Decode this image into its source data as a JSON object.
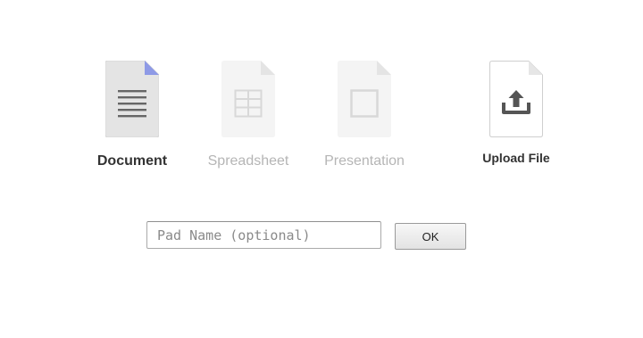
{
  "pad_types": [
    {
      "label": "Document",
      "icon": "document-lines-icon",
      "selected": true
    },
    {
      "label": "Spreadsheet",
      "icon": "spreadsheet-grid-icon",
      "selected": false
    },
    {
      "label": "Presentation",
      "icon": "presentation-square-icon",
      "selected": false
    }
  ],
  "upload": {
    "label": "Upload File",
    "icon": "upload-icon"
  },
  "pad_name": {
    "placeholder": "Pad Name (optional)",
    "value": ""
  },
  "ok_button": {
    "label": "OK"
  },
  "colors": {
    "selected_doc_fill": "#e4e4e4",
    "selected_doc_corner": "#8e9ae6",
    "dim_doc_fill": "#f4f4f4",
    "dim_doc_corner": "#e6e6e6",
    "selected_label": "#333333",
    "dim_label": "#b5b5b5"
  }
}
